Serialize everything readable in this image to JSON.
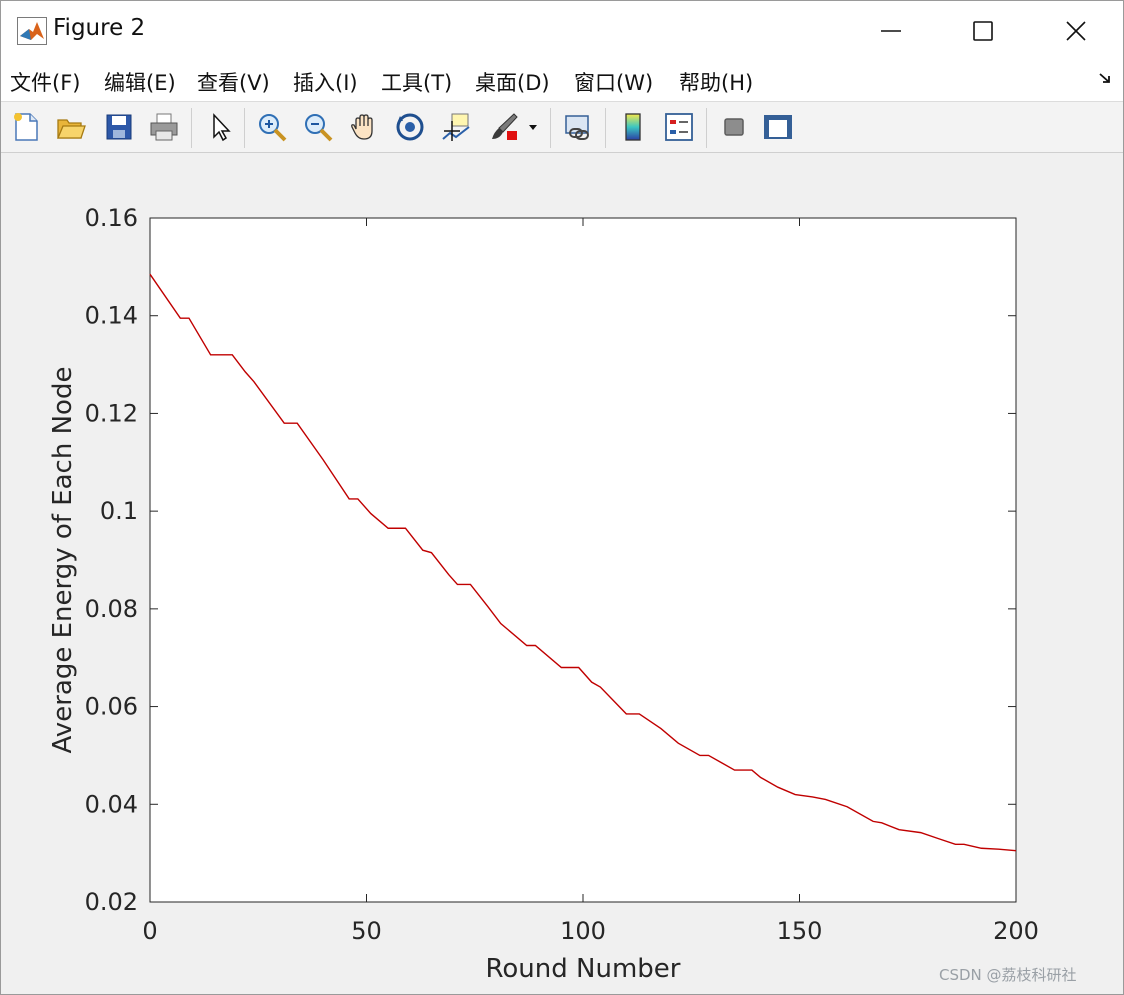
{
  "window": {
    "title": "Figure 2",
    "controls": [
      "minimize",
      "maximize",
      "close"
    ]
  },
  "menu": {
    "items": [
      "文件(F)",
      "编辑(E)",
      "查看(V)",
      "插入(I)",
      "工具(T)",
      "桌面(D)",
      "窗口(W)",
      "帮助(H)"
    ]
  },
  "toolbar": {
    "icons": [
      "new-figure-icon",
      "open-file-icon",
      "save-icon",
      "print-icon",
      "select-arrow-icon",
      "zoom-in-icon",
      "zoom-out-icon",
      "pan-hand-icon",
      "rotate-3d-icon",
      "data-cursor-icon",
      "brush-icon",
      "link-plot-icon",
      "colorbar-icon",
      "legend-icon",
      "hide-plot-tools-icon",
      "show-plot-tools-icon"
    ]
  },
  "colors": {
    "line": "#c00000",
    "axes": "#262626",
    "plot_bg": "#ffffff",
    "figure_bg": "#f0f0f0"
  },
  "chart_data": {
    "type": "line",
    "title": "",
    "xlabel": "Round Number",
    "ylabel": "Average Energy of Each Node",
    "xlim": [
      0,
      200
    ],
    "ylim": [
      0.02,
      0.16
    ],
    "xticks": [
      0,
      50,
      100,
      150,
      200
    ],
    "xtick_labels": [
      "0",
      "50",
      "100",
      "150",
      "200"
    ],
    "yticks": [
      0.02,
      0.04,
      0.06,
      0.08,
      0.1,
      0.12,
      0.14,
      0.16
    ],
    "ytick_labels": [
      "0.02",
      "0.04",
      "0.06",
      "0.08",
      "0.1",
      "0.12",
      "0.14",
      "0.16"
    ],
    "grid": false,
    "series": [
      {
        "x": [
          0,
          7,
          9,
          14,
          19,
          22,
          24,
          31,
          34,
          40,
          46,
          48,
          51,
          55,
          59,
          63,
          65,
          69,
          71,
          74,
          78,
          81,
          87,
          89,
          95,
          99,
          102,
          104,
          110,
          113,
          118,
          122,
          127,
          129,
          132,
          135,
          139,
          141,
          145,
          149,
          153,
          156,
          161,
          167,
          169,
          173,
          178,
          182,
          186,
          188,
          192,
          196,
          200
        ],
        "y": [
          0.1485,
          0.1395,
          0.1395,
          0.132,
          0.132,
          0.1285,
          0.1265,
          0.118,
          0.118,
          0.1105,
          0.1025,
          0.1025,
          0.0995,
          0.0965,
          0.0965,
          0.092,
          0.0915,
          0.087,
          0.085,
          0.085,
          0.0805,
          0.077,
          0.0725,
          0.0725,
          0.068,
          0.068,
          0.065,
          0.064,
          0.0585,
          0.0585,
          0.0555,
          0.0525,
          0.05,
          0.05,
          0.0485,
          0.047,
          0.047,
          0.0455,
          0.0435,
          0.042,
          0.0415,
          0.041,
          0.0395,
          0.0365,
          0.0362,
          0.0348,
          0.0342,
          0.033,
          0.0318,
          0.0318,
          0.031,
          0.0308,
          0.0305
        ]
      }
    ]
  },
  "watermark": "CSDN @荔枝科研社"
}
